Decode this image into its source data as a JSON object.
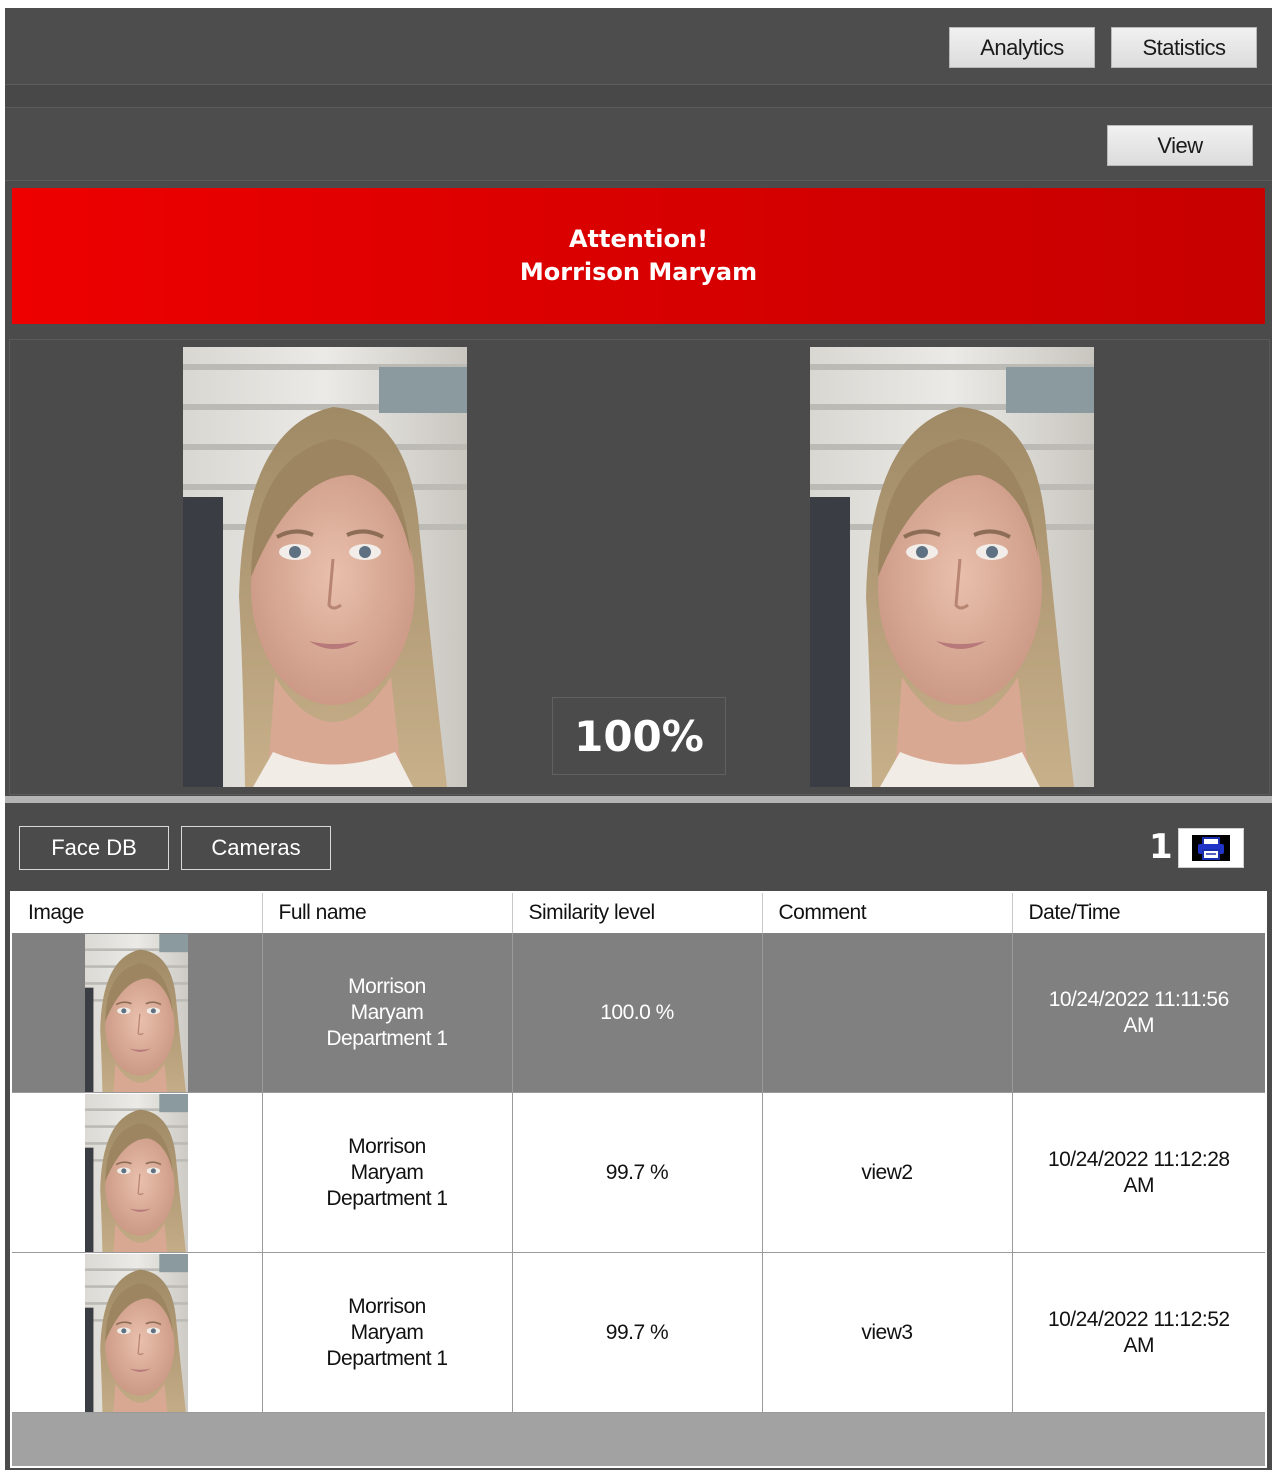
{
  "toolbar": {
    "analytics_label": "Analytics",
    "statistics_label": "Statistics",
    "view_label": "View"
  },
  "alert": {
    "line1": "Attention!",
    "line2": "Morrison Maryam",
    "color": "#e00000"
  },
  "match": {
    "similarity": "100%"
  },
  "tabs": {
    "face_db_label": "Face DB",
    "cameras_label": "Cameras",
    "count": "1",
    "print_icon": "printer-icon"
  },
  "table": {
    "columns": [
      "Image",
      "Full name",
      "Similarity level",
      "Comment",
      "Date/Time"
    ],
    "rows": [
      {
        "name_line1": "Morrison",
        "name_line2": "Maryam",
        "name_line3": "Department 1",
        "similarity": "100.0 %",
        "comment": "",
        "date": "10/24/2022 11:11:56",
        "time_suffix": "AM",
        "selected": true
      },
      {
        "name_line1": "Morrison",
        "name_line2": "Maryam",
        "name_line3": "Department 1",
        "similarity": "99.7 %",
        "comment": "view2",
        "date": "10/24/2022 11:12:28",
        "time_suffix": "AM",
        "selected": false
      },
      {
        "name_line1": "Morrison",
        "name_line2": "Maryam",
        "name_line3": "Department 1",
        "similarity": "99.7 %",
        "comment": "view3",
        "date": "10/24/2022 11:12:52",
        "time_suffix": "AM",
        "selected": false
      }
    ]
  }
}
